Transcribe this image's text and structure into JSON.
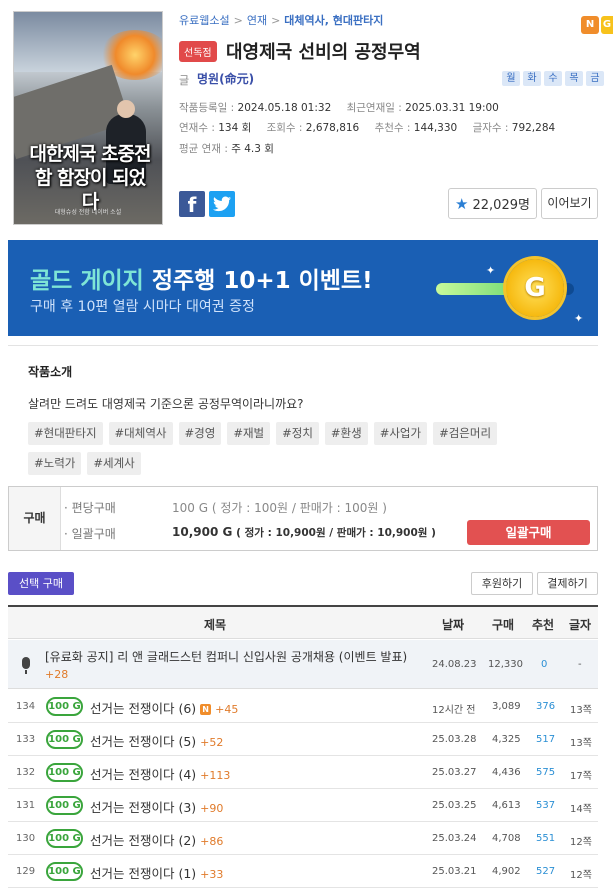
{
  "novel": {
    "cover_title": "대한제국 초중전함 함장이 되었다",
    "cover_subtitle": "대형슈성 전함 네이버 소설",
    "breadcrumb": [
      "유료웹소설",
      "연재",
      "대체역사, 현대판타지"
    ],
    "badges": [
      "N",
      "G"
    ],
    "exclusive": "선독점",
    "title": "대영제국 선비의 공정무역",
    "author_label": "글",
    "author": "명원(命元)",
    "days": [
      "월",
      "화",
      "수",
      "목",
      "금"
    ],
    "meta": {
      "registered_label": "작품등록일 :",
      "registered": "2024.05.18 01:32",
      "latest_label": "최근연재일 :",
      "latest": "2025.03.31 19:00",
      "episodes_label": "연재수 :",
      "episodes": "134 회",
      "views_label": "조회수 :",
      "views": "2,678,816",
      "recommends_label": "추천수 :",
      "recommends": "144,330",
      "chars_label": "글자수 :",
      "chars": "792,284",
      "avg_label": "평균 연재 :",
      "avg": "주 4.3 회"
    },
    "favorites": "22,029명",
    "continue": "이어보기"
  },
  "banner": {
    "line1_a": "골드 게이지",
    "line1_b": "정주행 10+1 이벤트!",
    "line2": "구매 후 10편 열람 시마다 대여권 증정",
    "coin": "G",
    "gauge_fill": 0.72
  },
  "intro": {
    "heading": "작품소개",
    "text": "살려만 드려도 대영제국 기준으론 공정무역이라니까요?",
    "tags": [
      "#현대판타지",
      "#대체역사",
      "#경영",
      "#재벌",
      "#정치",
      "#환생",
      "#사업가",
      "#검은머리",
      "#노력가",
      "#세계사"
    ]
  },
  "purchase": {
    "label": "구매",
    "single_label": "· 편당구매",
    "single_price": "100 G",
    "single_detail": "( 정가 : 100원 / 판매가 : 100원 )",
    "bulk_label": "· 일괄구매",
    "bulk_price": "10,900 G",
    "bulk_detail": "( 정가 : 10,900원 / 판매가 : 10,900원 )",
    "bulk_button": "일괄구매"
  },
  "toolbar": {
    "select_buy": "선택 구매",
    "support": "후원하기",
    "settle": "결제하기"
  },
  "table": {
    "headers": [
      "제목",
      "날짜",
      "구매",
      "추천",
      "글자"
    ],
    "notice": {
      "title": "[유료화 공지] 리 앤 글래드스턴 컴퍼니 신입사원 공개채용 (이벤트 발표)",
      "plus": "+28",
      "date": "24.08.23",
      "buys": "12,330",
      "recs": "0",
      "chars": "-"
    },
    "rows": [
      {
        "no": "134",
        "price": "100 G",
        "title": "선거는 전쟁이다 (6)",
        "new": "N",
        "plus": "+45",
        "date": "12시간 전",
        "buys": "3,089",
        "recs": "376",
        "chars": "13쪽"
      },
      {
        "no": "133",
        "price": "100 G",
        "title": "선거는 전쟁이다 (5)",
        "new": "",
        "plus": "+52",
        "date": "25.03.28",
        "buys": "4,325",
        "recs": "517",
        "chars": "13쪽"
      },
      {
        "no": "132",
        "price": "100 G",
        "title": "선거는 전쟁이다 (4)",
        "new": "",
        "plus": "+113",
        "date": "25.03.27",
        "buys": "4,436",
        "recs": "575",
        "chars": "17쪽"
      },
      {
        "no": "131",
        "price": "100 G",
        "title": "선거는 전쟁이다 (3)",
        "new": "",
        "plus": "+90",
        "date": "25.03.25",
        "buys": "4,613",
        "recs": "537",
        "chars": "14쪽"
      },
      {
        "no": "130",
        "price": "100 G",
        "title": "선거는 전쟁이다 (2)",
        "new": "",
        "plus": "+86",
        "date": "25.03.24",
        "buys": "4,708",
        "recs": "551",
        "chars": "12쪽"
      },
      {
        "no": "129",
        "price": "100 G",
        "title": "선거는 전쟁이다 (1)",
        "new": "",
        "plus": "+33",
        "date": "25.03.21",
        "buys": "4,902",
        "recs": "527",
        "chars": "12쪽"
      }
    ]
  }
}
